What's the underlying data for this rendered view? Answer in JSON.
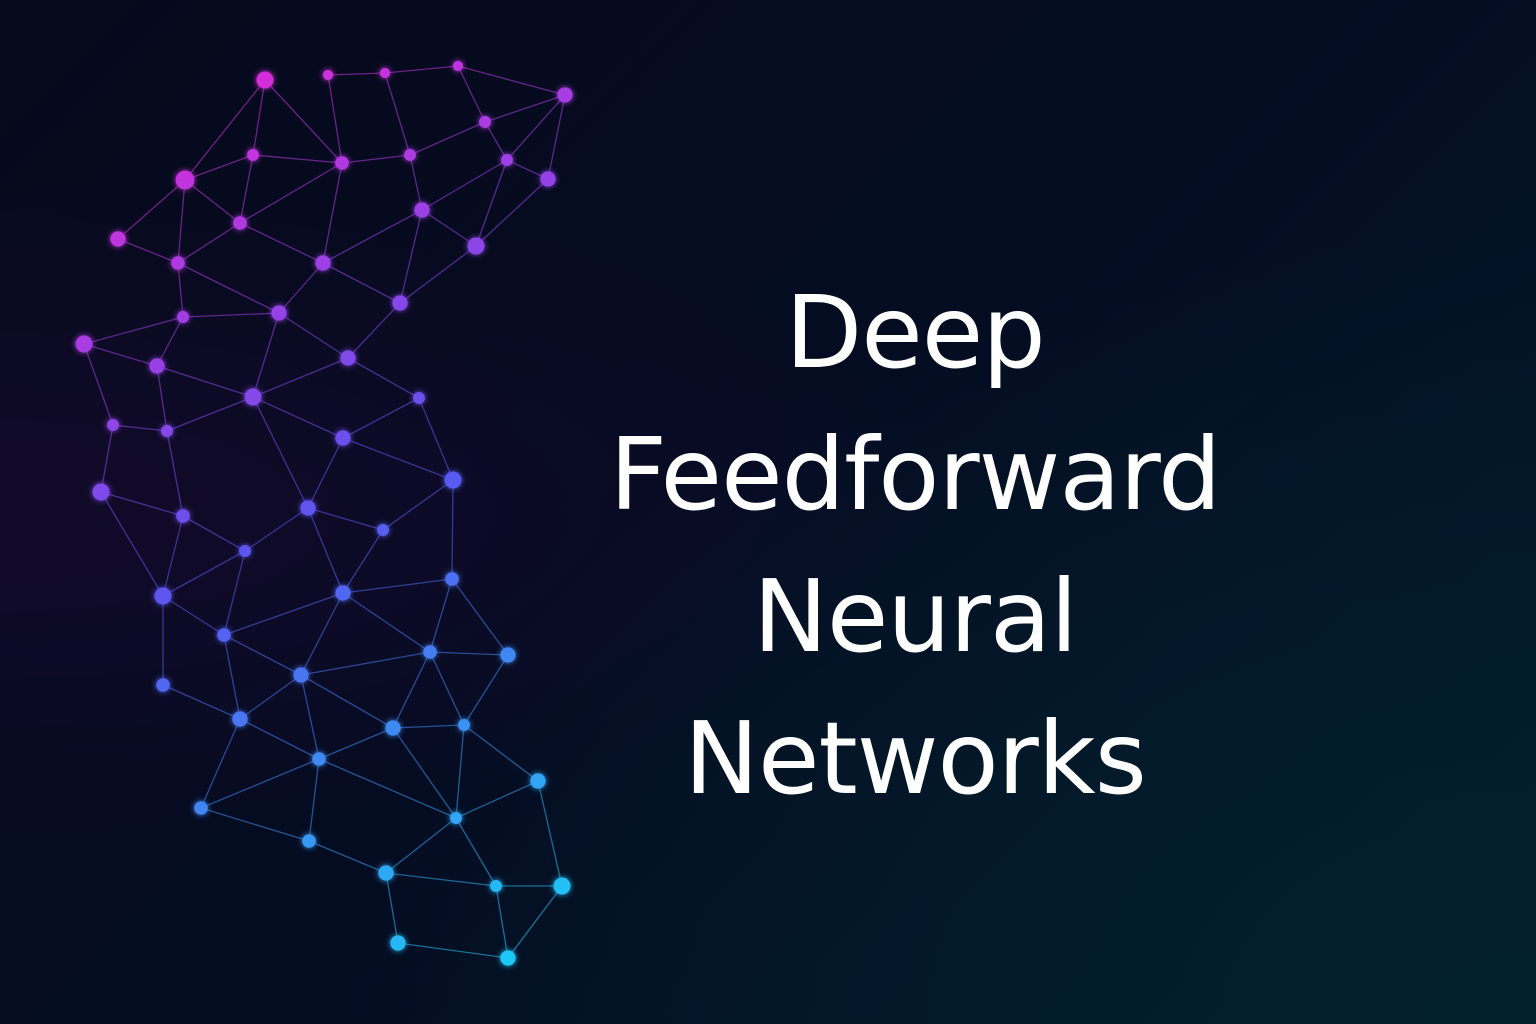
{
  "title": {
    "lines": [
      "Deep",
      "Feedforward",
      "Neural",
      "Networks"
    ]
  },
  "colors": {
    "background": "#050a1f",
    "text": "#ffffff",
    "gradient_top": "#e02ad8",
    "gradient_mid": "#6a4df0",
    "gradient_bottom": "#1fc6f5"
  }
}
